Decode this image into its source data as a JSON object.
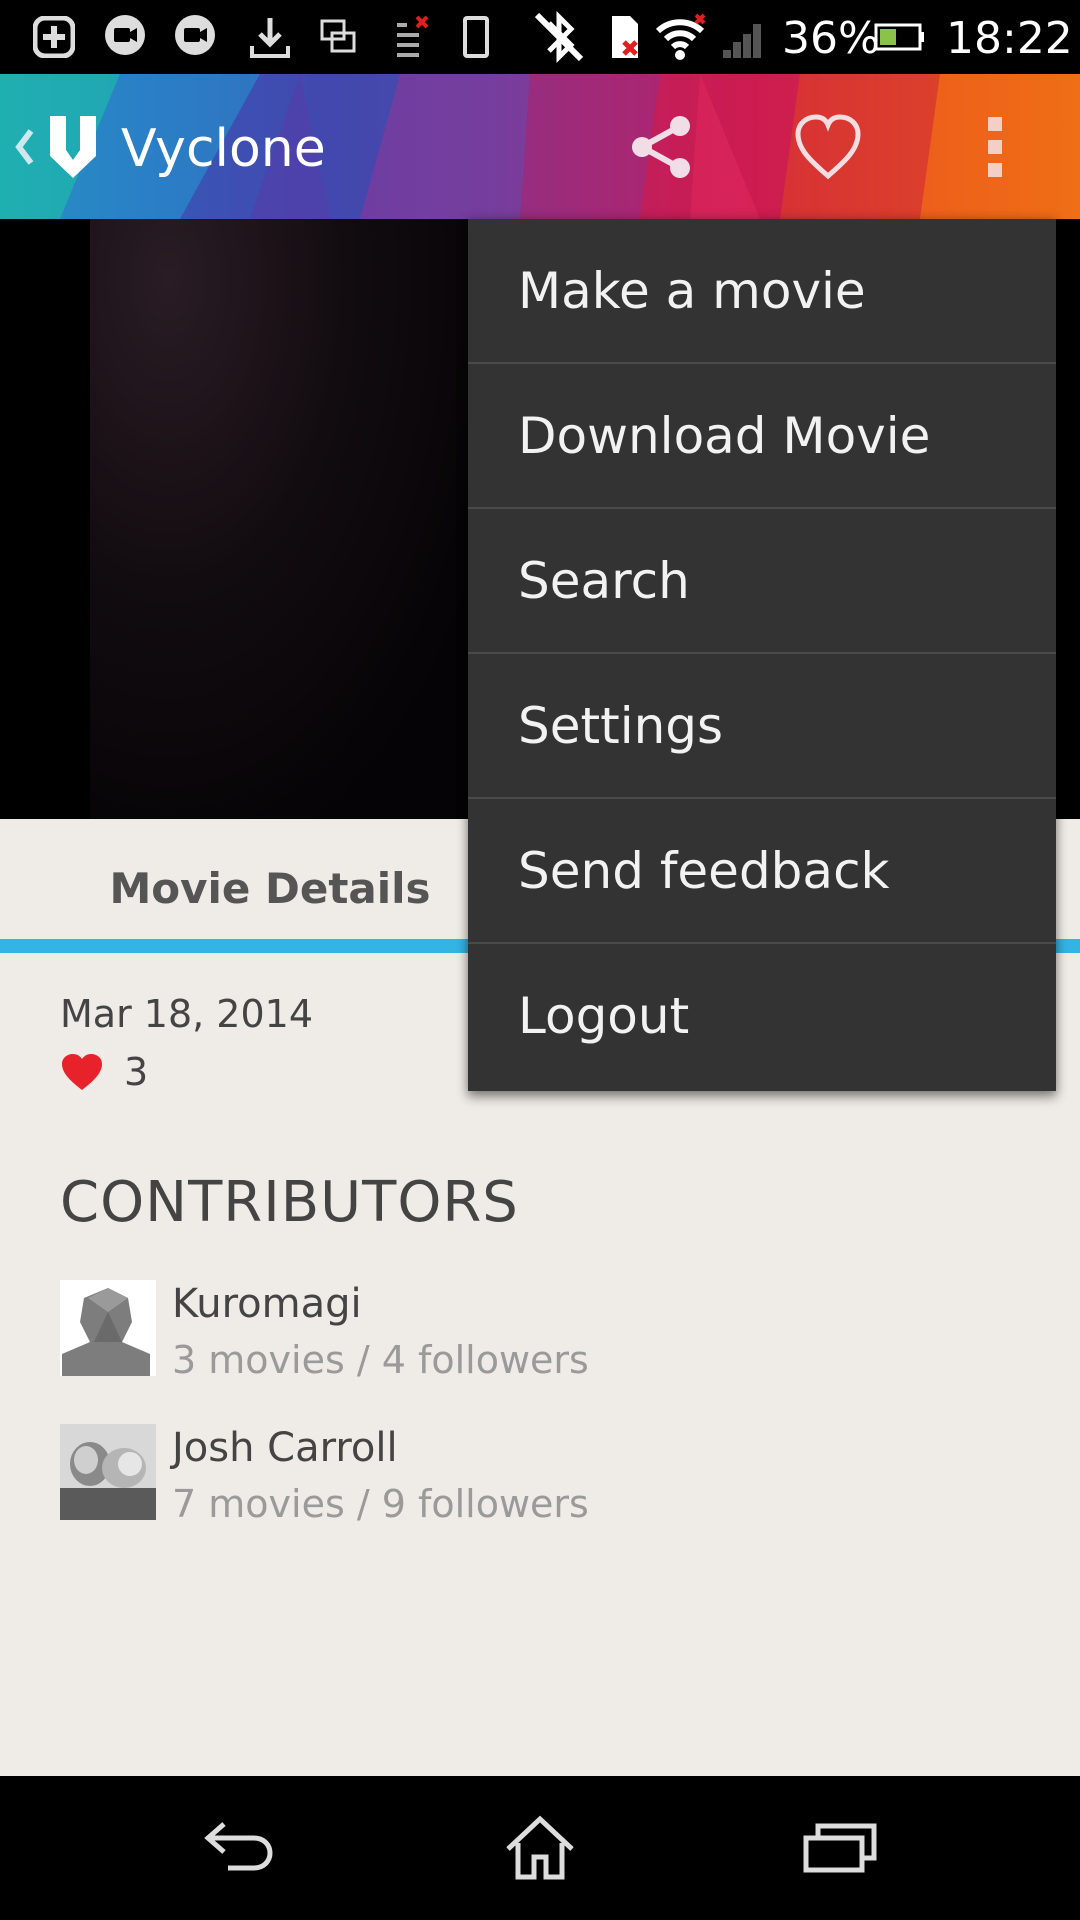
{
  "status_bar": {
    "battery_percent": "36%",
    "time": "18:22",
    "icons": [
      "add-box-icon",
      "hangouts-icon",
      "hangouts-video-icon",
      "download-icon",
      "window-icon",
      "data-blocked-icon",
      "phone-outline-icon",
      "bluetooth-off-icon",
      "sd-card-error-icon",
      "wifi-icon",
      "signal-icon",
      "battery-icon"
    ]
  },
  "action_bar": {
    "title": "Vyclone",
    "icons": [
      "back-chevron-icon",
      "vyclone-logo-icon",
      "share-icon",
      "heart-outline-icon",
      "overflow-menu-icon"
    ]
  },
  "tabs": [
    {
      "label": "Movie Details",
      "selected": true
    }
  ],
  "movie": {
    "date": "Mar 18, 2014",
    "likes": "3"
  },
  "contributors": {
    "title": "CONTRIBUTORS",
    "items": [
      {
        "name": "Kuromagi",
        "meta": "3 movies / 4 followers",
        "avatar": "default-avatar-icon"
      },
      {
        "name": "Josh Carroll",
        "meta": "7 movies / 9 followers",
        "avatar": "photo-avatar"
      }
    ]
  },
  "menu": {
    "items": [
      "Make a movie",
      "Download Movie",
      "Search",
      "Settings",
      "Send feedback",
      "Logout"
    ]
  },
  "nav_bar": {
    "icons": [
      "back-icon",
      "home-icon",
      "recents-icon"
    ]
  },
  "colors": {
    "tab_indicator": "#34b4e4",
    "menu_background": "#333333",
    "page_background": "#efebe6",
    "heart": "#e8222b"
  }
}
